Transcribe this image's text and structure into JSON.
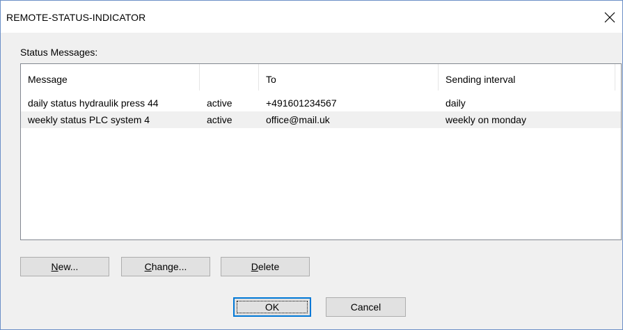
{
  "window": {
    "title": "REMOTE-STATUS-INDICATOR"
  },
  "group": {
    "label": "Status Messages:"
  },
  "list": {
    "columns": [
      "Message",
      "",
      "To",
      "Sending interval"
    ],
    "rows": [
      {
        "message": "daily status hydraulik press 44",
        "state": "active",
        "to": "+491601234567",
        "interval": "daily"
      },
      {
        "message": "weekly status PLC system 4",
        "state": "active",
        "to": "office@mail.uk",
        "interval": "weekly on monday"
      }
    ],
    "selected_row": 1
  },
  "buttons": {
    "new": {
      "mnemonic": "N",
      "rest": "ew..."
    },
    "change": {
      "mnemonic": "C",
      "rest": "hange..."
    },
    "delete": {
      "mnemonic": "D",
      "rest": "elete"
    },
    "ok": "OK",
    "cancel": "Cancel"
  },
  "icons": {
    "close": "close-icon"
  },
  "colors": {
    "accent": "#0078d7",
    "selection": "#f0f0f0",
    "dialog_bg": "#f0f0f0"
  }
}
